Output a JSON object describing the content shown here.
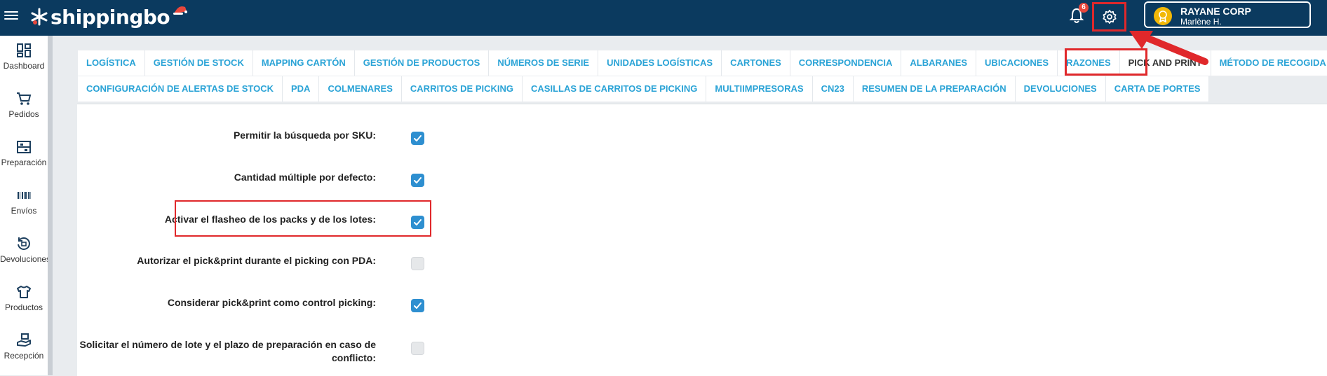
{
  "topbar": {
    "logo_text": "shippingbo",
    "notification_count": "6",
    "account_name": "RAYANE CORP",
    "account_user": "Marlène H."
  },
  "sidebar": {
    "items": [
      {
        "label": "Dashboard",
        "icon": "dashboard-icon"
      },
      {
        "label": "Pedidos",
        "icon": "cart-icon"
      },
      {
        "label": "Preparación",
        "icon": "preparation-icon"
      },
      {
        "label": "Envíos",
        "icon": "barcode-icon"
      },
      {
        "label": "Devoluciones",
        "icon": "returns-icon"
      },
      {
        "label": "Productos",
        "icon": "shirt-icon"
      },
      {
        "label": "Recepción",
        "icon": "reception-icon"
      }
    ]
  },
  "tabs": {
    "row1": [
      "LOGÍSTICA",
      "GESTIÓN DE STOCK",
      "MAPPING CARTÓN",
      "GESTIÓN DE PRODUCTOS",
      "NÚMEROS DE SERIE",
      "UNIDADES LOGÍSTICAS",
      "CARTONES",
      "CORRESPONDENCIA",
      "ALBARANES",
      "UBICACIONES",
      "RAZONES",
      "PICK AND PRINT",
      "MÉTODO DE RECOGIDA"
    ],
    "row2": [
      "CONFIGURACIÓN DE ALERTAS DE STOCK",
      "PDA",
      "COLMENARES",
      "CARRITOS DE PICKING",
      "CASILLAS DE CARRITOS DE PICKING",
      "MULTIIMPRESORAS",
      "CN23",
      "RESUMEN DE LA PREPARACIÓN",
      "DEVOLUCIONES",
      "CARTA DE PORTES"
    ],
    "active": "PICK AND PRINT"
  },
  "settings": [
    {
      "label": "Permitir la búsqueda por SKU:",
      "checked": true
    },
    {
      "label": "Cantidad múltiple por defecto:",
      "checked": true
    },
    {
      "label": "Activar el flasheo de los packs y de los lotes:",
      "checked": true
    },
    {
      "label": "Autorizar el pick&print durante el picking con PDA:",
      "checked": false
    },
    {
      "label": "Considerar pick&print como control picking:",
      "checked": true
    },
    {
      "label": "Solicitar el número de lote y el plazo de preparación en caso de conflicto:",
      "checked": false
    }
  ],
  "colors": {
    "topbar": "#0b3a5f",
    "tab_text": "#2aa3d6",
    "checkbox_on": "#2e8fd0",
    "highlight": "#e0282b"
  }
}
